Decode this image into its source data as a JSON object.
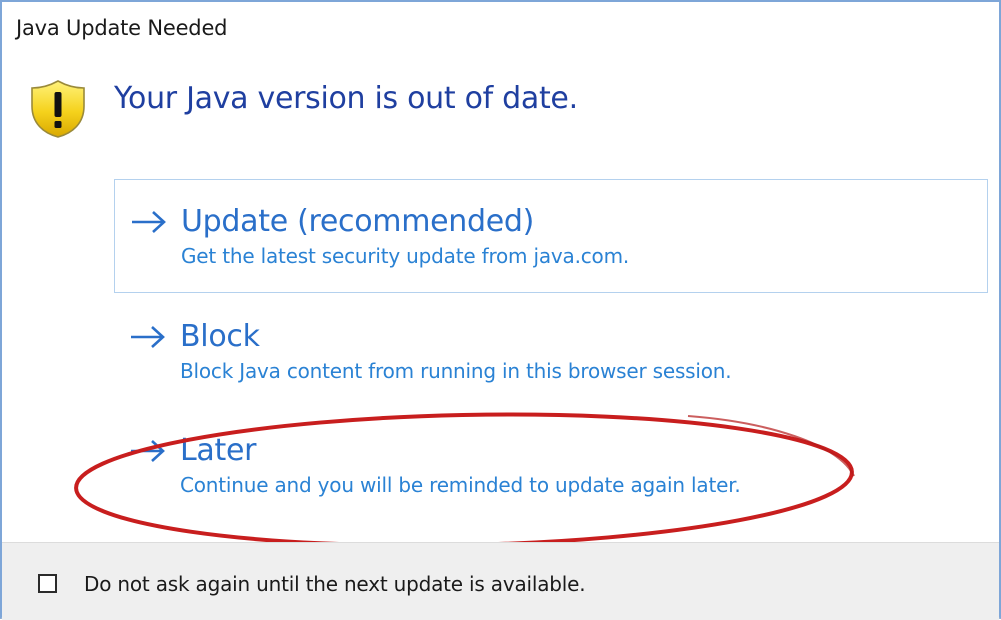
{
  "dialog": {
    "title": "Java Update Needed",
    "headline": "Your Java version is out of date.",
    "warning_icon": "shield-warning-icon"
  },
  "options": [
    {
      "title": "Update (recommended)",
      "description": "Get the latest security update from java.com."
    },
    {
      "title": "Block",
      "description": "Block Java content from running in this browser session."
    },
    {
      "title": "Later",
      "description": "Continue and you will be reminded to update again later."
    }
  ],
  "footer": {
    "checkbox_label": "Do not ask again until the next update is available.",
    "checkbox_checked": false
  },
  "colors": {
    "headline": "#1f3fa0",
    "option_title": "#2a6fc9",
    "option_desc": "#2a82d4",
    "highlight_ring": "#c81e1e",
    "footer_bg": "#efefef"
  }
}
